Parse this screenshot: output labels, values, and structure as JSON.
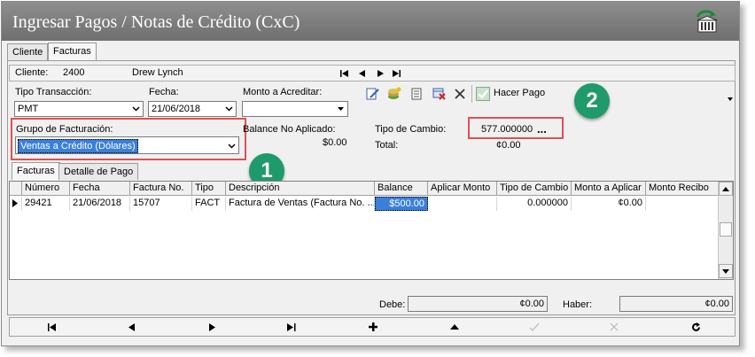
{
  "window": {
    "title": "Ingresar Pagos / Notas de Crédito (CxC)"
  },
  "tabs": [
    "Cliente",
    "Facturas"
  ],
  "client": {
    "label": "Cliente:",
    "code": "2400",
    "name": "Drew Lynch"
  },
  "form": {
    "tipo_transaccion_label": "Tipo Transacción:",
    "tipo_transaccion_value": "PMT",
    "fecha_label": "Fecha:",
    "fecha_value": "21/06/2018",
    "monto_label": "Monto a Acreditar:",
    "monto_value": "",
    "grupo_label": "Grupo de Facturación:",
    "grupo_value": "Ventas a Crédito (Dólares)",
    "balance_label": "Balance No Aplicado:",
    "balance_value": "$0.00",
    "tipo_cambio_label": "Tipo de Cambio:",
    "tipo_cambio_value": "577.000000",
    "tipo_cambio_btn": "...",
    "total_label": "Total:",
    "total_value": "¢0.00"
  },
  "toolbar": {
    "hacer_pago_label": "Hacer Pago"
  },
  "badges": [
    "1",
    "2"
  ],
  "subtabs": [
    "Facturas",
    "Detalle de Pago"
  ],
  "grid": {
    "columns": [
      "Número",
      "Fecha",
      "Factura No.",
      "Tipo",
      "Descripción",
      "Balance",
      "Aplicar Monto",
      "Tipo de Cambio",
      "Monto a Aplicar",
      "Monto Recibo"
    ],
    "rows": [
      [
        "29421",
        "21/06/2018",
        "15707",
        "FACT",
        "Factura de Ventas (Factura No. ...",
        "$500.00",
        "",
        "0.000000",
        "¢0.00",
        ""
      ]
    ]
  },
  "totals": {
    "debe_label": "Debe:",
    "debe_value": "¢0.00",
    "haber_label": "Haber:",
    "haber_value": "¢0.00"
  },
  "colors": {
    "title_bar": "#7f7f7f",
    "highlight": "#e15050",
    "badge": "#1f9a6b",
    "selected_cell": "#3b7fd9"
  }
}
